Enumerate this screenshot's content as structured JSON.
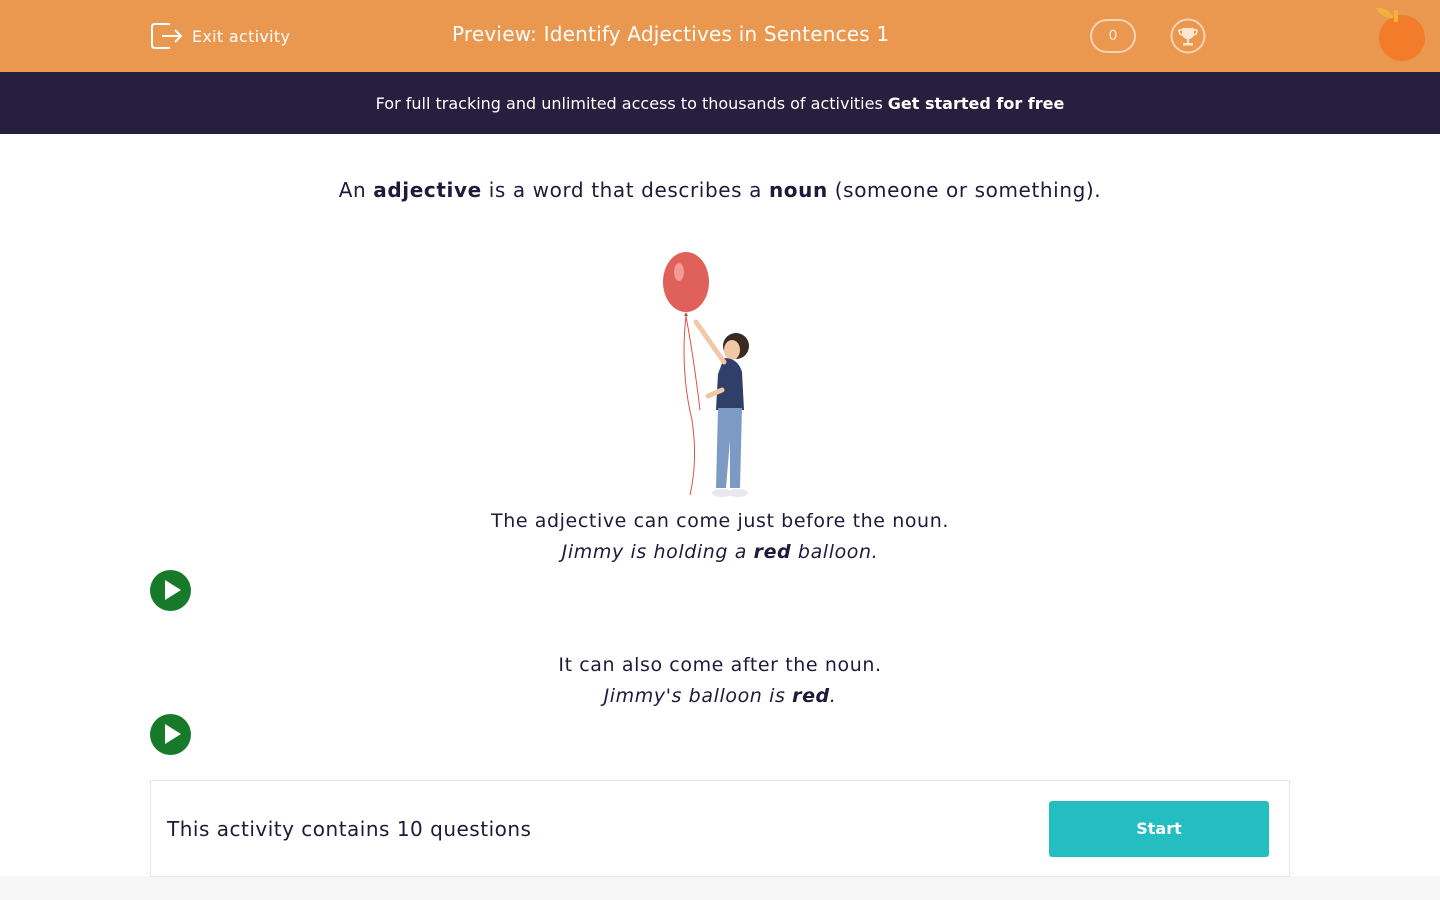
{
  "header": {
    "exit_label": "Exit activity",
    "title": "Preview: Identify Adjectives in Sentences 1",
    "score": "0",
    "bg_color": "#ea9850"
  },
  "banner": {
    "text": "For full tracking and unlimited access to thousands of activities",
    "cta": "Get started for free"
  },
  "intro": {
    "part1": "An ",
    "term1": "adjective",
    "part2": " is a word that describes a ",
    "term2": "noun",
    "part3": " (someone or something)."
  },
  "example1": {
    "rule": "The adjective can come just before the noun.",
    "sentence_before": "Jimmy is holding a ",
    "adjective": "red",
    "sentence_after": " balloon."
  },
  "example2": {
    "rule": "It can also come after the noun.",
    "sentence_before": "Jimmy's balloon is ",
    "adjective": "red",
    "sentence_after": "."
  },
  "summary": {
    "text": "This activity contains 10 questions",
    "start_label": "Start",
    "start_color": "#25bec0"
  },
  "icons": {
    "exit": "exit-icon",
    "trophy": "trophy-icon",
    "play": "play-icon"
  }
}
